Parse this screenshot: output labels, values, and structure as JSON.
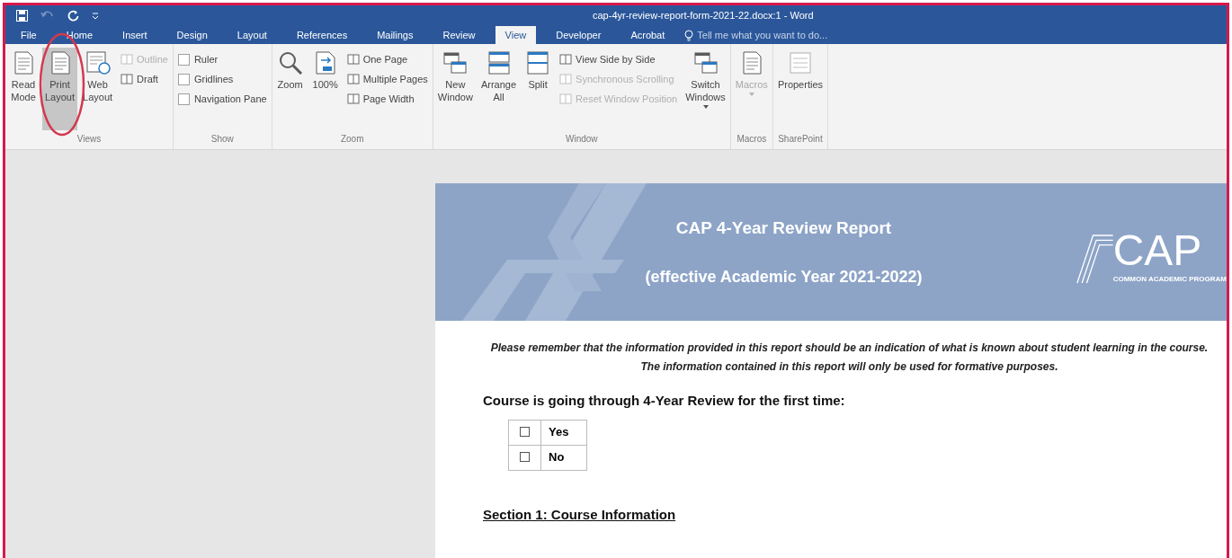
{
  "title_bar": {
    "title": "cap-4yr-review-report-form-2021-22.docx:1 - Word"
  },
  "tabs": [
    {
      "label": "File",
      "selected": false
    },
    {
      "label": "Home",
      "selected": false
    },
    {
      "label": "Insert",
      "selected": false
    },
    {
      "label": "Design",
      "selected": false
    },
    {
      "label": "Layout",
      "selected": false
    },
    {
      "label": "References",
      "selected": false
    },
    {
      "label": "Mailings",
      "selected": false
    },
    {
      "label": "Review",
      "selected": false
    },
    {
      "label": "View",
      "selected": true
    },
    {
      "label": "Developer",
      "selected": false
    },
    {
      "label": "Acrobat",
      "selected": false
    }
  ],
  "tell_me": {
    "placeholder": "Tell me what you want to do..."
  },
  "ribbon_groups": [
    {
      "label": "Views",
      "items": [
        {
          "kind": "large",
          "lines": [
            "Read",
            "Mode"
          ],
          "selected": false,
          "disabled": false
        },
        {
          "kind": "large",
          "lines": [
            "Print",
            "Layout"
          ],
          "selected": true,
          "disabled": false
        },
        {
          "kind": "large",
          "lines": [
            "Web",
            "Layout"
          ],
          "selected": false,
          "disabled": false
        },
        {
          "kind": "column",
          "children": [
            {
              "kind": "small",
              "label": "Outline",
              "disabled": true
            },
            {
              "kind": "small",
              "label": "Draft",
              "disabled": false
            }
          ]
        }
      ]
    },
    {
      "label": "Show",
      "items": [
        {
          "kind": "column",
          "children": [
            {
              "kind": "check",
              "label": "Ruler",
              "checked": false
            },
            {
              "kind": "check",
              "label": "Gridlines",
              "checked": false
            },
            {
              "kind": "check",
              "label": "Navigation Pane",
              "checked": false
            }
          ]
        }
      ]
    },
    {
      "label": "Zoom",
      "items": [
        {
          "kind": "large",
          "lines": [
            "Zoom"
          ],
          "selected": false,
          "disabled": false
        },
        {
          "kind": "large",
          "lines": [
            "100%"
          ],
          "selected": false,
          "disabled": false
        },
        {
          "kind": "column",
          "children": [
            {
              "kind": "small",
              "label": "One Page",
              "disabled": false
            },
            {
              "kind": "small",
              "label": "Multiple Pages",
              "disabled": false
            },
            {
              "kind": "small",
              "label": "Page Width",
              "disabled": false
            }
          ]
        }
      ]
    },
    {
      "label": "Window",
      "items": [
        {
          "kind": "large",
          "lines": [
            "New",
            "Window"
          ],
          "selected": false,
          "disabled": false
        },
        {
          "kind": "large",
          "lines": [
            "Arrange",
            "All"
          ],
          "selected": false,
          "disabled": false
        },
        {
          "kind": "large",
          "lines": [
            "Split"
          ],
          "selected": false,
          "disabled": false
        },
        {
          "kind": "column",
          "children": [
            {
              "kind": "small",
              "label": "View Side by Side",
              "disabled": false
            },
            {
              "kind": "small",
              "label": "Synchronous Scrolling",
              "disabled": true
            },
            {
              "kind": "small",
              "label": "Reset Window Position",
              "disabled": true
            }
          ]
        },
        {
          "kind": "dropdown",
          "lines": [
            "Switch",
            "Windows"
          ],
          "selected": false,
          "disabled": false
        }
      ]
    },
    {
      "label": "Macros",
      "items": [
        {
          "kind": "dropdown",
          "lines": [
            "Macros"
          ],
          "selected": false,
          "disabled": true
        }
      ]
    },
    {
      "label": "SharePoint",
      "items": [
        {
          "kind": "large",
          "lines": [
            "Properties"
          ],
          "selected": false,
          "disabled": false
        }
      ]
    }
  ],
  "document": {
    "banner": {
      "title": "CAP 4-Year Review Report",
      "subtitle": "(effective Academic Year 2021-2022)",
      "logo_text": "CAP",
      "logo_tagline": "COMMON ACADEMIC PROGRAM"
    },
    "note": "Please remember that the information provided in this report should be an indication of what is known about student learning in the course. The information contained in this report will only be used for formative purposes.",
    "question": "Course is going through 4-Year Review for the first time:",
    "options": [
      {
        "label": "Yes",
        "checked": false
      },
      {
        "label": "No",
        "checked": false
      }
    ],
    "section_heading": "Section 1: Course Information"
  }
}
